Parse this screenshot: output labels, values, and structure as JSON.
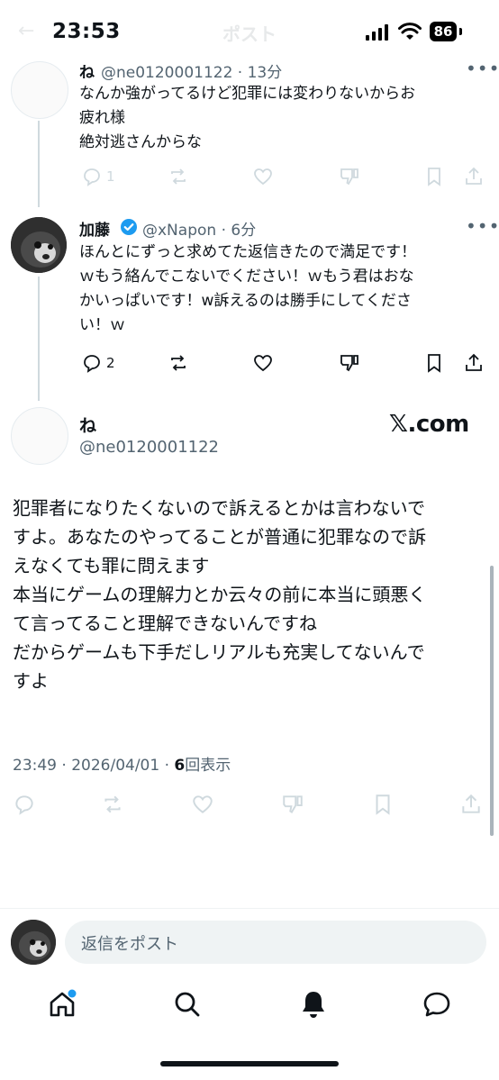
{
  "status_bar": {
    "time": "23:53",
    "battery": "86"
  },
  "header": {
    "back": "←",
    "title": "ポスト"
  },
  "tweets": [
    {
      "name": "ね",
      "handle_time": "@ne0120001122 · 13分",
      "text": "なんか強がってるけど犯罪には変わりないからお\n疲れ様\n絶対逃さんからな",
      "reply_count": "1",
      "more": "•••"
    },
    {
      "name": "加藤",
      "handle_time": "@xNapon · 6分",
      "text": "ほんとにずっと求めてた返信きたので満足です！\nｗもう絡んでこないでください！ｗもう君はおな\nかいっぱいです！w訴えるのは勝手にしてくださ\nい！ｗ",
      "reply_count": "2",
      "more": "•••",
      "verified": true
    }
  ],
  "main_post": {
    "name": "ね",
    "handle": "@ne0120001122",
    "source_logo": "𝕏.com",
    "text": "犯罪者になりたくないので訴えるとかは言わないで\nすよ。あなたのやってることが普通に犯罪なので訴\nえなくても罪に問えます\n本当にゲームの理解力とか云々の前に本当に頭悪く\nて言ってること理解できないんですね\nだからゲームも下手だしリアルも充実してないんで\nすよ",
    "timestamp": "23:49 · 2026/04/01 · ",
    "views_count": "6",
    "views_label": "回表示"
  },
  "reply_bar": {
    "placeholder": "返信をポスト"
  },
  "tab_bar": [
    "home-icon",
    "search-icon",
    "notifications-icon",
    "messages-icon"
  ],
  "colors": {
    "accent": "#1d9bf0",
    "muted": "#536471",
    "pale": "#cfd9de"
  }
}
